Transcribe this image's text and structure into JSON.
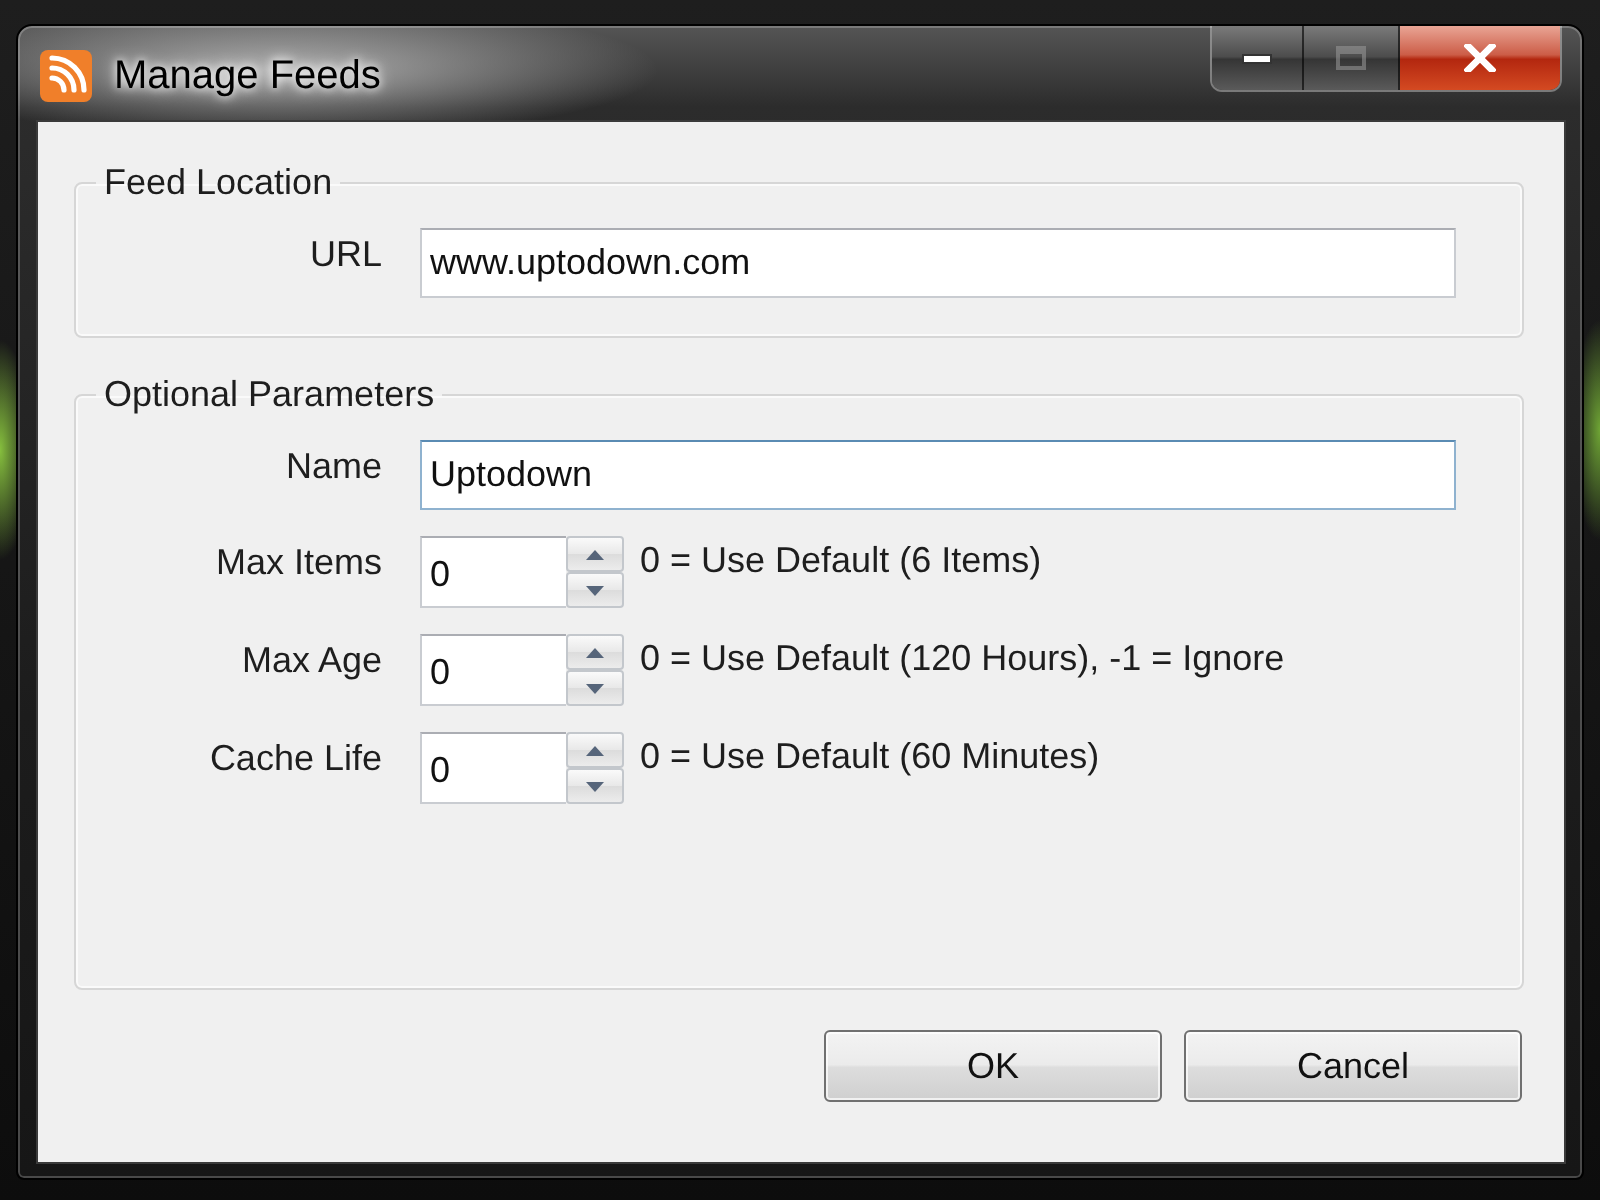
{
  "window": {
    "title": "Manage Feeds",
    "controls": [
      {
        "kind": "minimize",
        "disabled": false
      },
      {
        "kind": "maximize",
        "disabled": true
      },
      {
        "kind": "close",
        "disabled": false
      }
    ]
  },
  "feed_location": {
    "title": "Feed Location",
    "fields": [
      {
        "kind": "text",
        "label": "URL",
        "value": "www.uptodown.com",
        "focused": false
      }
    ]
  },
  "optional_parameters": {
    "title": "Optional Parameters",
    "fields": [
      {
        "kind": "text",
        "label": "Name",
        "value": "Uptodown",
        "focused": true
      },
      {
        "kind": "spinner",
        "label": "Max Items",
        "value": "0",
        "hint": "0 = Use Default (6 Items)",
        "focused": false
      },
      {
        "kind": "spinner",
        "label": "Max Age",
        "value": "0",
        "hint": "0 = Use Default (120 Hours), -1 = Ignore",
        "focused": false
      },
      {
        "kind": "spinner",
        "label": "Cache Life",
        "value": "0",
        "hint": "0 = Use Default (60 Minutes)",
        "focused": false
      }
    ]
  },
  "buttons": [
    {
      "label": "OK"
    },
    {
      "label": "Cancel"
    }
  ]
}
